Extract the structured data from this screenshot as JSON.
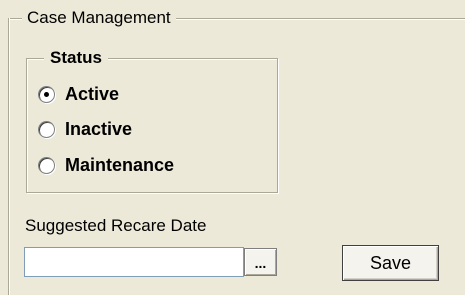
{
  "case_management": {
    "title": "Case Management",
    "status": {
      "title": "Status",
      "options": [
        {
          "label": "Active",
          "selected": true
        },
        {
          "label": "Inactive",
          "selected": false
        },
        {
          "label": "Maintenance",
          "selected": false
        }
      ]
    },
    "recare_date": {
      "label": "Suggested Recare Date",
      "value": "",
      "button_label": "..."
    },
    "save_label": "Save"
  }
}
